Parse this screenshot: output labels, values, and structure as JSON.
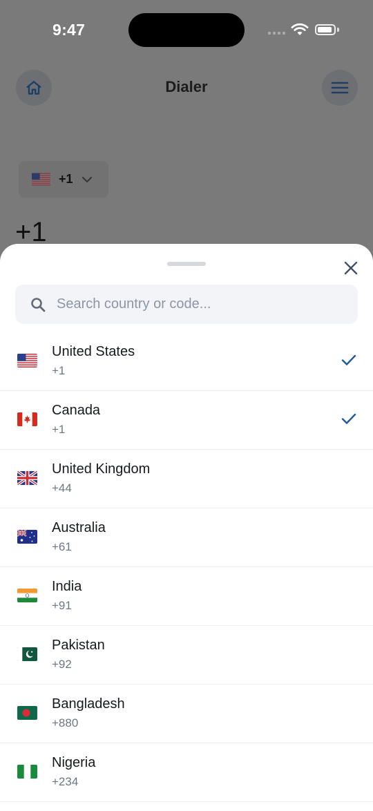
{
  "status_bar": {
    "time": "9:47"
  },
  "header": {
    "title": "Dialer",
    "home_icon": "home-icon",
    "menu_icon": "menu-icon"
  },
  "country_picker": {
    "code": "+1",
    "flag": "flag-us-icon"
  },
  "dial": {
    "number": "+1"
  },
  "sheet": {
    "search_placeholder": "Search country or code...",
    "search_value": "",
    "countries": [
      {
        "name": "United States",
        "code": "+1",
        "flag": "us",
        "selected": true
      },
      {
        "name": "Canada",
        "code": "+1",
        "flag": "ca",
        "selected": true
      },
      {
        "name": "United Kingdom",
        "code": "+44",
        "flag": "gb",
        "selected": false
      },
      {
        "name": "Australia",
        "code": "+61",
        "flag": "au",
        "selected": false
      },
      {
        "name": "India",
        "code": "+91",
        "flag": "in",
        "selected": false
      },
      {
        "name": "Pakistan",
        "code": "+92",
        "flag": "pk",
        "selected": false
      },
      {
        "name": "Bangladesh",
        "code": "+880",
        "flag": "bd",
        "selected": false
      },
      {
        "name": "Nigeria",
        "code": "+234",
        "flag": "ng",
        "selected": false
      }
    ]
  },
  "colors": {
    "accent": "#1f5a96",
    "dim_overlay": "#7a7a7a",
    "sheet_bg": "#ffffff"
  }
}
